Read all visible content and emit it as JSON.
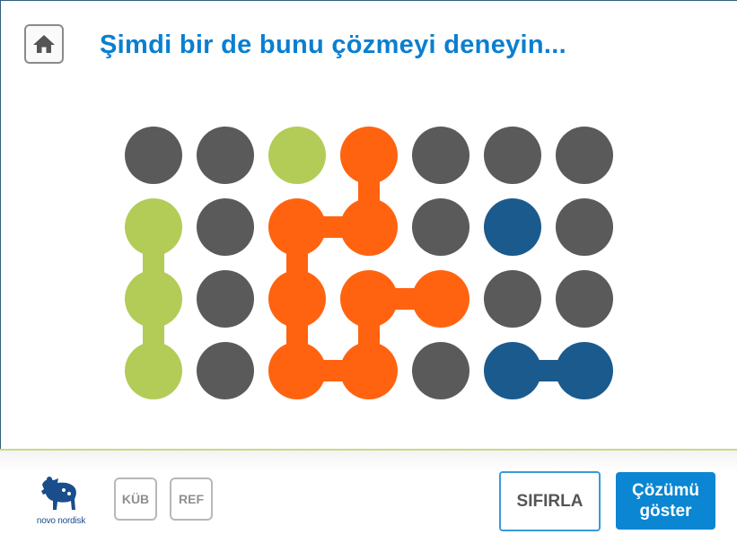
{
  "header": {
    "title": "Şimdi bir de bunu çözmeyi deneyin..."
  },
  "colors": {
    "empty": "#5a5a5a",
    "green": "#b2cc57",
    "orange": "#ff6310",
    "blue": "#1b5a8d",
    "title": "#0a7fd0"
  },
  "board": {
    "rows": 4,
    "cols": 7,
    "cells": [
      [
        "empty",
        "empty",
        "green",
        "orange",
        "empty",
        "empty",
        "empty"
      ],
      [
        "green",
        "empty",
        "orange",
        "orange",
        "empty",
        "blue",
        "empty"
      ],
      [
        "green",
        "empty",
        "orange",
        "orange",
        "orange",
        "empty",
        "empty"
      ],
      [
        "green",
        "empty",
        "orange",
        "orange",
        "empty",
        "blue",
        "blue"
      ]
    ],
    "links": [
      {
        "color": "green",
        "from": [
          1,
          0
        ],
        "to": [
          2,
          0
        ]
      },
      {
        "color": "green",
        "from": [
          2,
          0
        ],
        "to": [
          3,
          0
        ]
      },
      {
        "color": "orange",
        "from": [
          0,
          3
        ],
        "to": [
          1,
          3
        ]
      },
      {
        "color": "orange",
        "from": [
          1,
          3
        ],
        "to": [
          1,
          2
        ]
      },
      {
        "color": "orange",
        "from": [
          1,
          2
        ],
        "to": [
          2,
          2
        ]
      },
      {
        "color": "orange",
        "from": [
          2,
          2
        ],
        "to": [
          3,
          2
        ]
      },
      {
        "color": "orange",
        "from": [
          3,
          2
        ],
        "to": [
          3,
          3
        ]
      },
      {
        "color": "orange",
        "from": [
          3,
          3
        ],
        "to": [
          2,
          3
        ]
      },
      {
        "color": "orange",
        "from": [
          2,
          3
        ],
        "to": [
          2,
          4
        ]
      },
      {
        "color": "blue",
        "from": [
          3,
          5
        ],
        "to": [
          3,
          6
        ]
      }
    ]
  },
  "footer": {
    "logo_text": "novo nordisk",
    "kub_label": "KÜB",
    "ref_label": "REF",
    "reset_label": "SIFIRLA",
    "solution_label": "Çözümü\ngöster"
  },
  "icons": {
    "home": "home-icon",
    "logo": "apis-bull-icon"
  }
}
